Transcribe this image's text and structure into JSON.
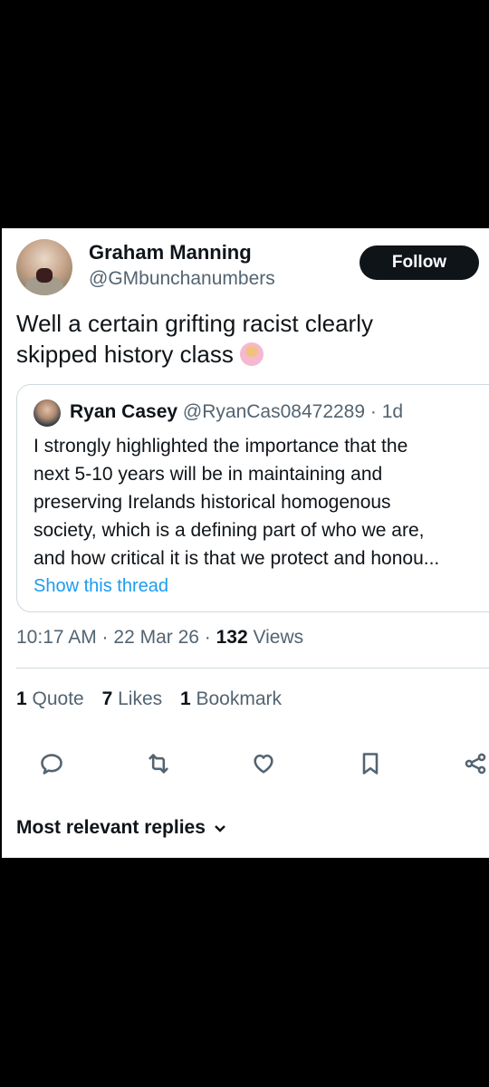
{
  "tweet": {
    "author_name": "Graham Manning",
    "author_handle": "@GMbunchanumbers",
    "follow_label": "Follow",
    "text": "Well a certain grifting racist clearly skipped history class",
    "emoji": "person-shrugging-emoji"
  },
  "quote": {
    "name": "Ryan Casey",
    "handle_time": "@RyanCas08472289 · 1d",
    "body": "I strongly highlighted the importance that the\nnext 5-10 years will be in maintaining and\npreserving Irelands historical homogenous\nsociety, which is a defining part of who we are,\nand how critical it is that we protect and honou...",
    "show_thread": "Show this thread"
  },
  "meta": {
    "time_date": "10:17 AM · 22 Mar 26 · ",
    "views_count": "132",
    "views_label": " Views"
  },
  "stats": [
    {
      "count": "1",
      "label": " Quote"
    },
    {
      "count": "7",
      "label": " Likes"
    },
    {
      "count": "1",
      "label": " Bookmark"
    }
  ],
  "actions": [
    "reply-icon",
    "retweet-icon",
    "like-icon",
    "bookmark-icon",
    "share-icon"
  ],
  "replies_sort_label": "Most relevant replies",
  "colors": {
    "text_primary": "#0f1419",
    "text_secondary": "#536471",
    "link": "#1d9bf0",
    "border": "#cfd9de",
    "background_outer": "#000000"
  }
}
